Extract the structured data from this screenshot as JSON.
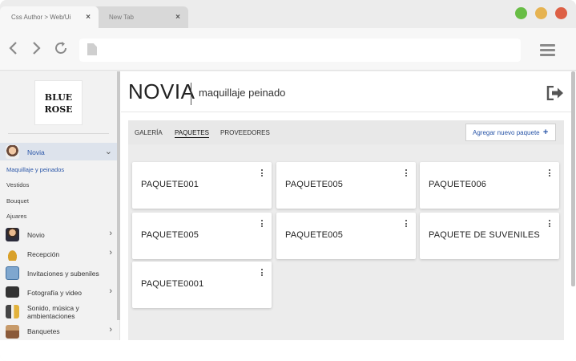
{
  "browser": {
    "tabs": [
      {
        "label": "Css Author > Web/Ui",
        "close": "×"
      },
      {
        "label": "New Tab",
        "close": "×"
      }
    ]
  },
  "sidebar": {
    "logo_line1": "BLUE",
    "logo_line2": "ROSE",
    "items": [
      {
        "label": "Novia",
        "chevron": "⌄",
        "icon": "bride-icon"
      },
      {
        "label": "Novio",
        "chevron": "›",
        "icon": "groom-icon"
      },
      {
        "label": "Recepción",
        "chevron": "›",
        "icon": "reception-bell-icon"
      },
      {
        "label": "Invitaciones y subeniles",
        "chevron": "",
        "icon": "envelope-icon"
      },
      {
        "label": "Fotografía y video",
        "chevron": "›",
        "icon": "camera-icon"
      },
      {
        "label": "Sonido, música y ambientaciones",
        "chevron": "",
        "icon": "speaker-icon"
      },
      {
        "label": "Banquetes",
        "chevron": "›",
        "icon": "banquet-icon"
      }
    ],
    "subitems": [
      {
        "label": "Maquillaje y peinados"
      },
      {
        "label": "Vestidos"
      },
      {
        "label": "Bouquet"
      },
      {
        "label": "Ajuares"
      }
    ]
  },
  "main": {
    "title": "NOVIA",
    "subtitle": "maquillaje peinado",
    "tabs": [
      {
        "label": "GALERÍA"
      },
      {
        "label": "PAQUETES"
      },
      {
        "label": "PROVEEDORES"
      }
    ],
    "add_label": "Agregar nuevo paquete",
    "add_plus": "+",
    "cards": [
      {
        "label": "PAQUETE001"
      },
      {
        "label": "PAQUETE005"
      },
      {
        "label": "PAQUETE006"
      },
      {
        "label": "PAQUETE005"
      },
      {
        "label": "PAQUETE005"
      },
      {
        "label": "PAQUETE DE SUVENILES"
      },
      {
        "label": "PAQUETE0001"
      }
    ]
  },
  "colors": {
    "accent": "#2a56a8",
    "window_green": "#68bd45",
    "window_yellow": "#e6b351",
    "window_red": "#dd6045"
  }
}
